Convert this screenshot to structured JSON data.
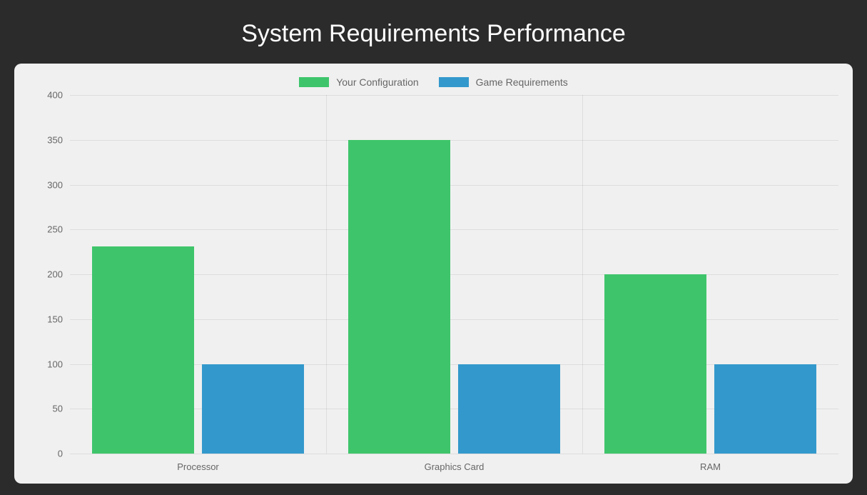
{
  "title": "System Requirements Performance",
  "legend": {
    "series1": "Your Configuration",
    "series2": "Game Requirements"
  },
  "chart_data": {
    "type": "bar",
    "categories": [
      "Processor",
      "Graphics Card",
      "RAM"
    ],
    "series": [
      {
        "name": "Your Configuration",
        "color": "#3ec56b",
        "values": [
          231,
          350,
          200
        ]
      },
      {
        "name": "Game Requirements",
        "color": "#3399cc",
        "values": [
          100,
          100,
          100
        ]
      }
    ],
    "ylim": [
      0,
      400
    ],
    "yticks": [
      0,
      50,
      100,
      150,
      200,
      250,
      300,
      350,
      400
    ],
    "title": "System Requirements Performance",
    "xlabel": "",
    "ylabel": ""
  }
}
